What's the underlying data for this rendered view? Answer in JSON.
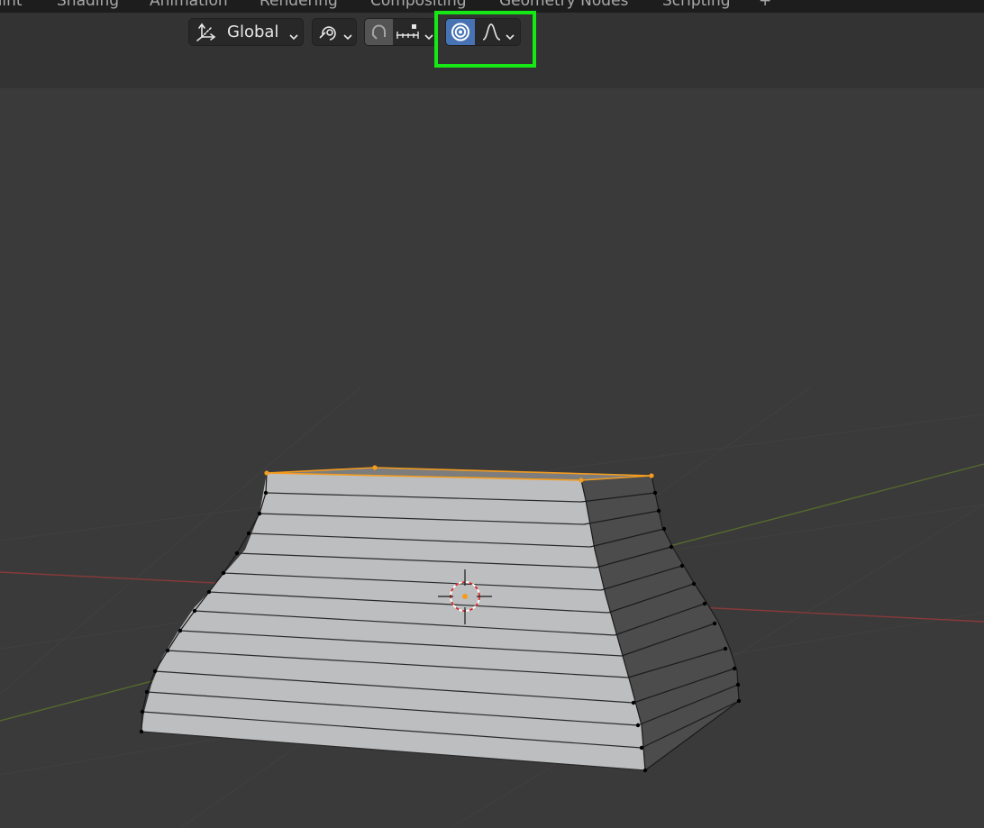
{
  "workspace_tabs": [
    "aint",
    "Shading",
    "Animation",
    "Rendering",
    "Compositing",
    "Geometry Nodes",
    "Scripting",
    "+"
  ],
  "toolbar": {
    "orientation_label": "Global",
    "orientation_icon": "transform-orientation-icon",
    "pivot_icon": "pivot-point-icon",
    "snap_icon": "snap-magnet-icon",
    "snap_target_icon": "snap-increment-icon",
    "proportional_edit_icon": "proportional-editing-icon",
    "falloff_icon": "smooth-falloff-icon"
  },
  "colors": {
    "header_bg": "#333333",
    "viewport_bg": "#3a3a3a",
    "active_toggle": "#4772b3",
    "highlight": "#16e816",
    "selection": "#f39c1e",
    "x_axis": "#9b3a3a",
    "y_axis": "#5f7a2e"
  },
  "mesh": {
    "object": "tapered-block",
    "selected_face": "top",
    "loop_count": 13
  }
}
